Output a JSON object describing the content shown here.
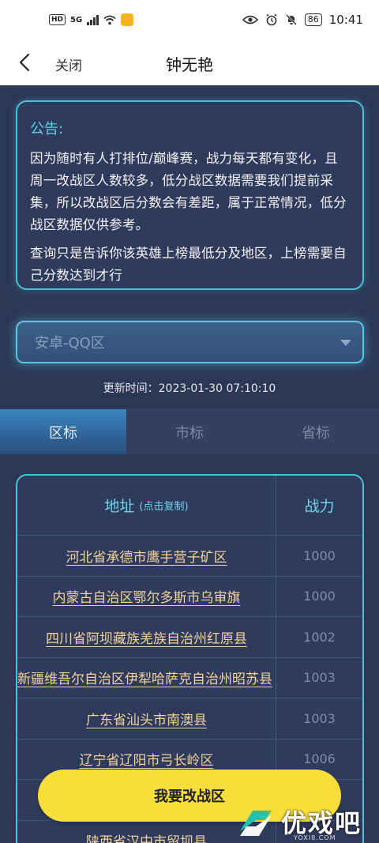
{
  "status_bar": {
    "hd": "HD",
    "signal": "5G",
    "battery": "86",
    "time": "10:41"
  },
  "nav": {
    "close_label": "关闭",
    "title": "钟无艳"
  },
  "notice": {
    "title": "公告:",
    "paragraph1": "因为随时有人打排位/巅峰赛，战力每天都有变化，且周一改战区人数较多，低分战区数据需要我们提前采集，所以改战区后分数会有差距，属于正常情况，低分战区数据仅供参考。",
    "paragraph2": "查询只是告诉你该英雄上榜最低分及地区，上榜需要自己分数达到才行"
  },
  "region_select": {
    "value": "安卓-QQ区"
  },
  "update_time": "更新时间：2023-01-30 07:10:10",
  "tabs": [
    {
      "label": "区标",
      "active": true
    },
    {
      "label": "市标",
      "active": false
    },
    {
      "label": "省标",
      "active": false
    }
  ],
  "table": {
    "header_address": "地址",
    "header_address_hint": "(点击复制)",
    "header_power": "战力",
    "rows": [
      {
        "address": "河北省承德市鹰手营子矿区",
        "power": "1000"
      },
      {
        "address": "内蒙古自治区鄂尔多斯市乌审旗",
        "power": "1000"
      },
      {
        "address": "四川省阿坝藏族羌族自治州红原县",
        "power": "1002"
      },
      {
        "address": "新疆维吾尔自治区伊犁哈萨克自治州昭苏县",
        "power": "1003"
      },
      {
        "address": "广东省汕头市南澳县",
        "power": "1003"
      },
      {
        "address": "辽宁省辽阳市弓长岭区",
        "power": "1006"
      },
      {
        "address": "",
        "power": ""
      },
      {
        "address": "陕西省汉中市留坝县",
        "power": ""
      }
    ]
  },
  "cta_label": "我要改战区",
  "watermark": {
    "main": "优戏吧",
    "sub": "YOXI8.COM"
  },
  "colors": {
    "accent": "#49c3d7",
    "background": "#2c3756",
    "cta": "#f8de3a",
    "address": "#f2d29a"
  }
}
